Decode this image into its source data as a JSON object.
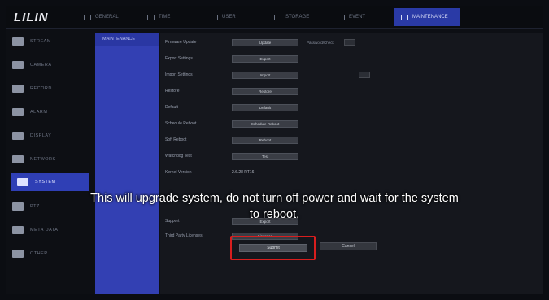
{
  "brand": {
    "logo": "LILIN"
  },
  "tabs": [
    {
      "label": "GENERAL",
      "icon": "sliders-icon"
    },
    {
      "label": "TIME",
      "icon": "calendar-icon"
    },
    {
      "label": "USER",
      "icon": "user-icon"
    },
    {
      "label": "STORAGE",
      "icon": "storage-icon"
    },
    {
      "label": "EVENT",
      "icon": "event-icon"
    },
    {
      "label": "MAINTENANCE",
      "icon": "maintenance-icon",
      "active": true
    }
  ],
  "left_menu": [
    {
      "label": "STREAM"
    },
    {
      "label": "CAMERA"
    },
    {
      "label": "RECORD"
    },
    {
      "label": "ALARM"
    },
    {
      "label": "DISPLAY"
    },
    {
      "label": "NETWORK"
    },
    {
      "label": "SYSTEM",
      "active": true
    },
    {
      "label": "PTZ"
    },
    {
      "label": "META DATA"
    },
    {
      "label": "OTHER"
    }
  ],
  "submenu": {
    "active_item": "MAINTENANCE"
  },
  "settings": {
    "firmware_update": {
      "label": "Firmware Update",
      "button": "Update",
      "extra_label": "Password/Check"
    },
    "export_settings": {
      "label": "Export Settings",
      "button": "Export"
    },
    "import_settings": {
      "label": "Import Settings",
      "button": "Import"
    },
    "restore": {
      "label": "Restore",
      "button": "Restore"
    },
    "default": {
      "label": "Default",
      "button": "Default"
    },
    "schedule_reboot": {
      "label": "Schedule Reboot",
      "button": "Schedule Reboot"
    },
    "soft_reboot": {
      "label": "Soft Reboot",
      "button": "Reboot"
    },
    "watchdog_test": {
      "label": "Watchdog Test",
      "button": "Test"
    },
    "kernel_version": {
      "label": "Kernel Version",
      "value": "2.6.28 RT16"
    },
    "support": {
      "label": "Support",
      "button": "Export"
    },
    "third_party": {
      "label": "Third Party Licenses",
      "button": "Licenses"
    }
  },
  "overlay_message": {
    "line1": "This will upgrade system, do not turn off power and wait for the system",
    "line2": "to reboot."
  },
  "actions": {
    "submit": "Submit",
    "cancel": "Cancel"
  },
  "colors": {
    "accent": "#2f3fb5",
    "highlight_box": "#d81e1e"
  }
}
